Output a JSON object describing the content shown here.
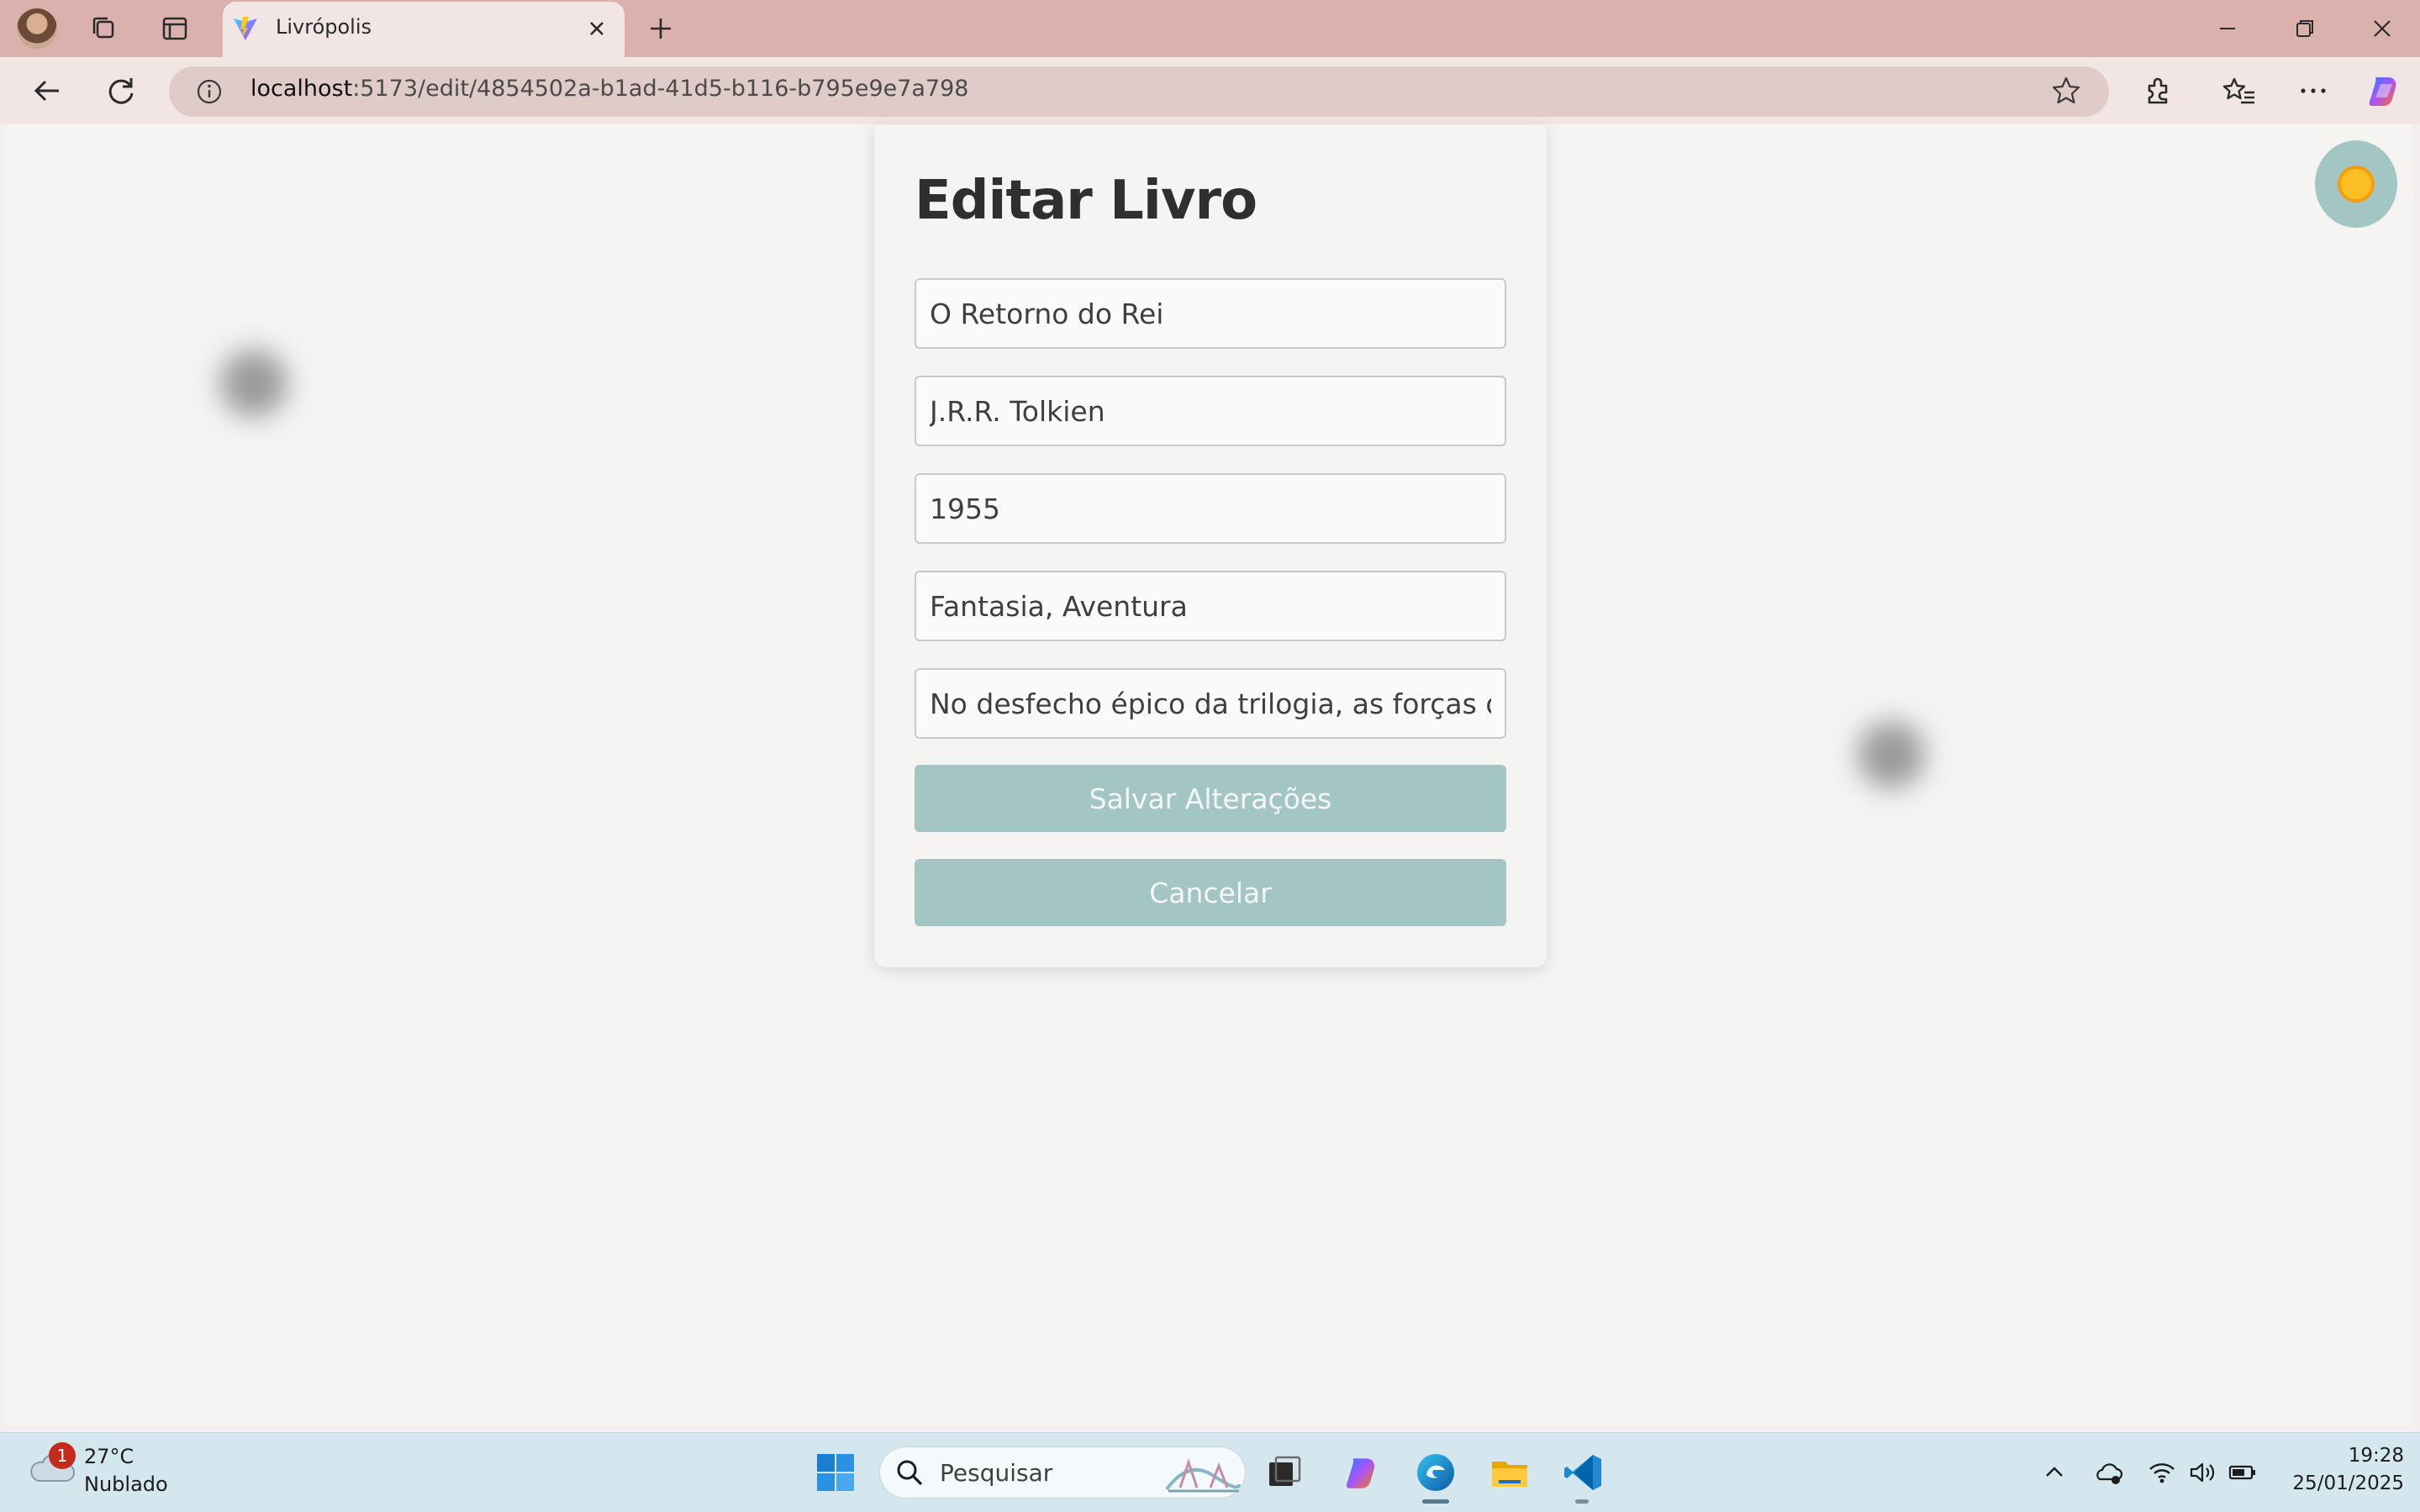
{
  "browser": {
    "tab_title": "Livrópolis",
    "url_host": "localhost",
    "url_path": ":5173/edit/4854502a-b1ad-41d5-b116-b795e9e7a798"
  },
  "page": {
    "title": "Editar Livro",
    "fields": {
      "title_value": "O Retorno do Rei",
      "author_value": "J.R.R. Tolkien",
      "year_value": "1955",
      "genre_value": "Fantasia, Aventura",
      "description_value": "No desfecho épico da trilogia, as forças de"
    },
    "save_label": "Salvar Alterações",
    "cancel_label": "Cancelar"
  },
  "taskbar": {
    "weather_temp": "27°C",
    "weather_desc": "Nublado",
    "weather_badge": "1",
    "search_placeholder": "Pesquisar",
    "time": "19:28",
    "date": "25/01/2025"
  },
  "colors": {
    "accent": "#a3c6c4",
    "titlebar": "#dbb1ad",
    "page_bg": "#f6f4f2",
    "toggle_sun": "#fbbf24"
  },
  "icons": [
    "profile-avatar",
    "workspaces-icon",
    "tab-actions-icon",
    "vite-logo-icon",
    "close-icon",
    "plus-icon",
    "minimize-icon",
    "restore-icon",
    "back-icon",
    "refresh-icon",
    "info-icon",
    "star-icon",
    "extensions-icon",
    "favorites-icon",
    "more-icon",
    "copilot-icon",
    "sun-icon",
    "weather-icon",
    "windows-start-icon",
    "search-icon",
    "task-view-icon",
    "edge-icon",
    "file-explorer-icon",
    "vscode-icon",
    "chevron-up-icon",
    "onedrive-icon",
    "wifi-icon",
    "volume-icon",
    "battery-icon"
  ]
}
